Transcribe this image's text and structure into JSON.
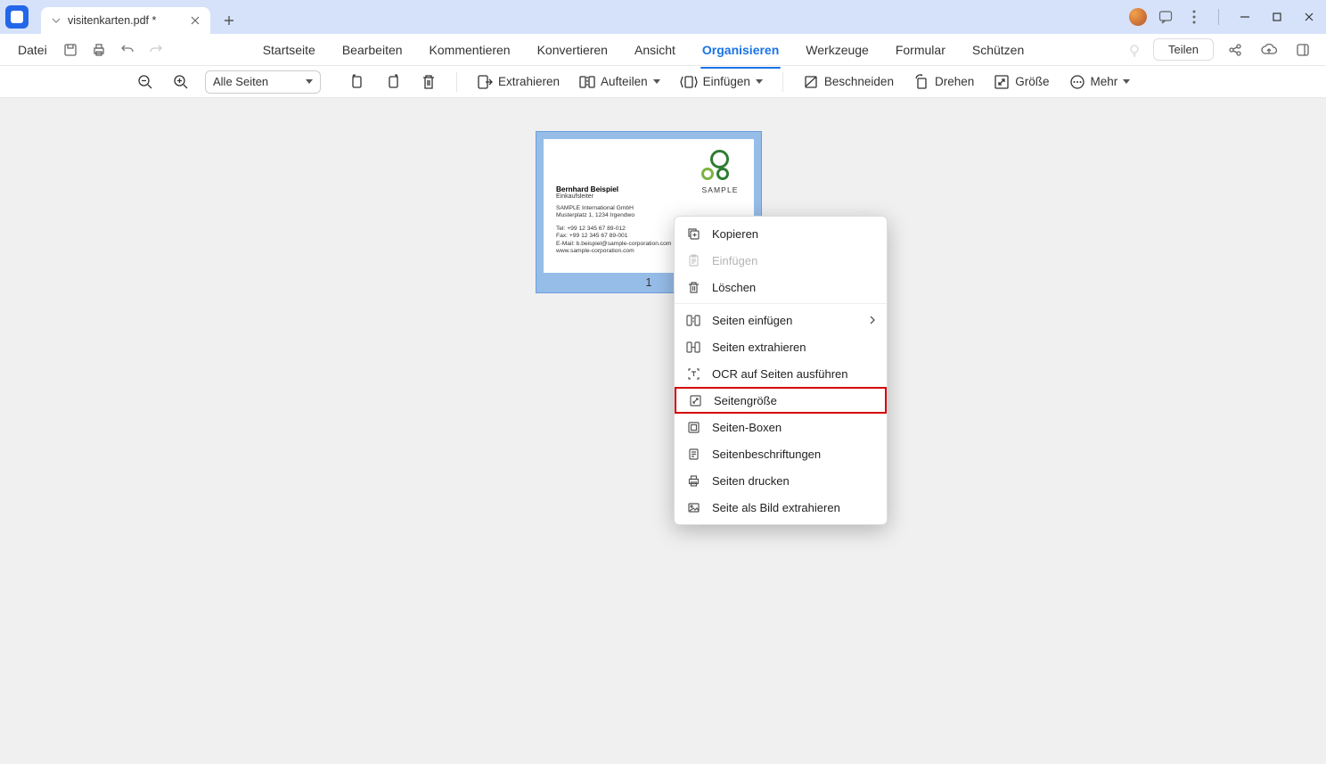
{
  "tab": {
    "title": "visitenkarten.pdf *"
  },
  "menu": {
    "file": "Datei",
    "items": [
      "Startseite",
      "Bearbeiten",
      "Kommentieren",
      "Konvertieren",
      "Ansicht",
      "Organisieren",
      "Werkzeuge",
      "Formular",
      "Schützen"
    ],
    "active_index": 5,
    "share": "Teilen"
  },
  "toolbar": {
    "pages_select": "Alle Seiten",
    "extract": "Extrahieren",
    "split": "Aufteilen",
    "insert": "Einfügen",
    "crop": "Beschneiden",
    "rotate": "Drehen",
    "size": "Größe",
    "more": "Mehr"
  },
  "page": {
    "number": "1",
    "card": {
      "name": "Bernhard Beispiel",
      "role": "Einkaufsleiter",
      "company": "SAMPLE International GmbH",
      "address": "Musterplatz 1, 1234 Irgendwo",
      "tel": "Tel: +99 12 345 67 89-012",
      "fax": "Fax: +99 12 345 67 89-001",
      "email": "E-Mail: b.beispiel@sample-corporation.com",
      "web": "www.sample-corporation.com",
      "logo_text": "SAMPLE"
    }
  },
  "ctx": {
    "copy": "Kopieren",
    "paste": "Einfügen",
    "delete": "Löschen",
    "insert_pages": "Seiten einfügen",
    "extract_pages": "Seiten extrahieren",
    "ocr": "OCR auf Seiten ausführen",
    "page_size": "Seitengröße",
    "page_boxes": "Seiten-Boxen",
    "page_labels": "Seitenbeschriftungen",
    "print_pages": "Seiten drucken",
    "extract_image": "Seite als Bild extrahieren"
  }
}
